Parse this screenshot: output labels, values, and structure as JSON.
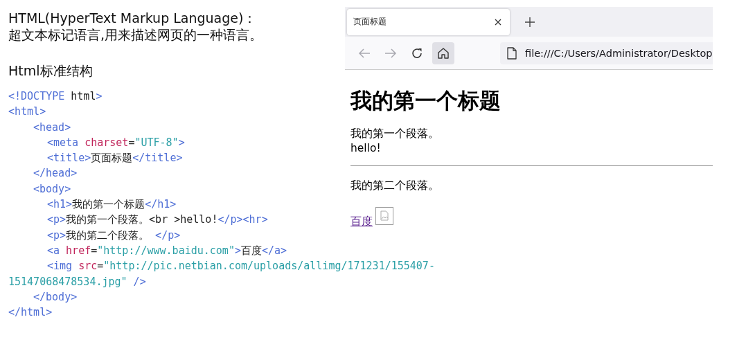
{
  "intro": {
    "heading": "HTML(HyperText Markup Language)：",
    "description": "超文本标记语言,用来描述网页的一种语言。"
  },
  "section_title": "Html标准结构",
  "code": [
    {
      "tokens": [
        {
          "kind": "tag",
          "text": "<!DOCTYPE"
        },
        {
          "kind": "text",
          "text": " html"
        },
        {
          "kind": "tag",
          "text": ">"
        }
      ]
    },
    {
      "tokens": [
        {
          "kind": "tag",
          "text": "<html>"
        }
      ],
      "close": [
        {
          "kind": "tag",
          "text": "</html>"
        }
      ],
      "children": [
        {
          "tokens": [
            {
              "kind": "tag",
              "text": "<head>"
            }
          ],
          "close": [
            {
              "kind": "tag",
              "text": "</head>"
            }
          ],
          "children": [
            {
              "tokens": [
                {
                  "kind": "tag",
                  "text": "<meta"
                },
                {
                  "kind": "attr",
                  "text": " charset"
                },
                {
                  "kind": "text",
                  "text": "="
                },
                {
                  "kind": "value",
                  "text": "\"UTF-8\""
                },
                {
                  "kind": "tag",
                  "text": ">"
                }
              ]
            },
            {
              "tokens": [
                {
                  "kind": "tag",
                  "text": "<title>"
                },
                {
                  "kind": "text",
                  "text": "页面标题"
                },
                {
                  "kind": "tag",
                  "text": "</title>"
                }
              ]
            }
          ]
        },
        {
          "tokens": [
            {
              "kind": "tag",
              "text": "<body>"
            }
          ],
          "close": [
            {
              "kind": "tag",
              "text": "</body>"
            }
          ],
          "children": [
            {
              "tokens": [
                {
                  "kind": "tag",
                  "text": "<h1>"
                },
                {
                  "kind": "text",
                  "text": "我的第一个标题"
                },
                {
                  "kind": "tag",
                  "text": "</h1>"
                }
              ]
            },
            {
              "tokens": [
                {
                  "kind": "tag",
                  "text": "<p>"
                },
                {
                  "kind": "text",
                  "text": "我的第一个段落。<br >hello!"
                },
                {
                  "kind": "tag",
                  "text": "</p><hr>"
                }
              ]
            },
            {
              "tokens": [
                {
                  "kind": "tag",
                  "text": "<p>"
                },
                {
                  "kind": "text",
                  "text": "我的第二个段落。"
                },
                {
                  "kind": "tag",
                  "text": " </p>"
                }
              ]
            },
            {
              "tokens": [
                {
                  "kind": "tag",
                  "text": "<a"
                },
                {
                  "kind": "attr",
                  "text": " href"
                },
                {
                  "kind": "text",
                  "text": "="
                },
                {
                  "kind": "value",
                  "text": "\"http://www.baidu.com\""
                },
                {
                  "kind": "tag",
                  "text": ">"
                },
                {
                  "kind": "text",
                  "text": "百度"
                },
                {
                  "kind": "tag",
                  "text": "</a>"
                }
              ]
            },
            {
              "tokens": [
                {
                  "kind": "tag",
                  "text": "<img"
                },
                {
                  "kind": "attr",
                  "text": " src"
                },
                {
                  "kind": "text",
                  "text": "="
                },
                {
                  "kind": "value",
                  "text": "\"http://pic.netbian.com/uploads/allimg/171231/155407-"
                }
              ],
              "continuation": [
                {
                  "kind": "value",
                  "text": "15147068478534.jpg\""
                },
                {
                  "kind": "tag",
                  "text": " />"
                }
              ]
            }
          ]
        }
      ]
    }
  ],
  "browser": {
    "tabs": [
      {
        "label": "页面标题",
        "selected": true
      }
    ],
    "toolbar": [
      {
        "kind": "back",
        "disabled": true,
        "hovered": false
      },
      {
        "kind": "forward",
        "disabled": true,
        "hovered": false
      },
      {
        "kind": "reload",
        "disabled": false,
        "hovered": false
      },
      {
        "kind": "home",
        "disabled": false,
        "hovered": true
      }
    ],
    "address": "file:///C:/Users/Administrator/Desktop",
    "content": [
      {
        "kind": "heading",
        "text": "我的第一个标题"
      },
      {
        "kind": "paragraph",
        "lines": [
          "我的第一个段落。",
          "hello!"
        ]
      },
      {
        "kind": "rule"
      },
      {
        "kind": "paragraph",
        "lines": [
          "我的第二个段落。"
        ]
      },
      {
        "kind": "inline",
        "items": [
          {
            "kind": "link",
            "text": "百度"
          },
          {
            "kind": "broken_image"
          }
        ]
      }
    ]
  }
}
